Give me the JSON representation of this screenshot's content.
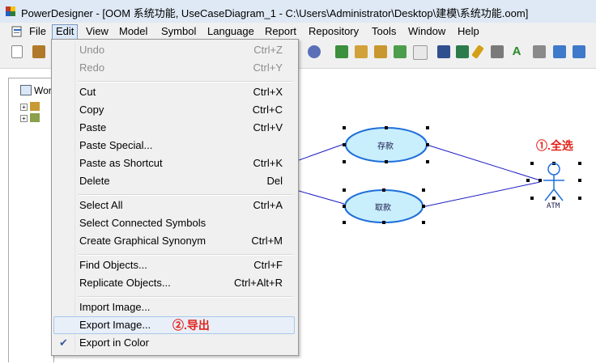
{
  "window": {
    "title": "PowerDesigner - [OOM 系统功能, UseCaseDiagram_1 - C:\\Users\\Administrator\\Desktop\\建模\\系统功能.oom]"
  },
  "menubar": {
    "items": [
      {
        "label": "File",
        "active": false
      },
      {
        "label": "Edit",
        "active": true
      },
      {
        "label": "View",
        "active": false
      },
      {
        "label": "Model",
        "active": false
      },
      {
        "label": "Symbol",
        "active": false
      },
      {
        "label": "Language",
        "active": false
      },
      {
        "label": "Report",
        "active": false
      },
      {
        "label": "Repository",
        "active": false
      },
      {
        "label": "Tools",
        "active": false
      },
      {
        "label": "Window",
        "active": false
      },
      {
        "label": "Help",
        "active": false
      }
    ]
  },
  "edit_menu": {
    "items": [
      {
        "label": "Undo",
        "shortcut": "Ctrl+Z",
        "disabled": true
      },
      {
        "label": "Redo",
        "shortcut": "Ctrl+Y",
        "disabled": true
      },
      {
        "label": "Cut",
        "shortcut": "Ctrl+X"
      },
      {
        "label": "Copy",
        "shortcut": "Ctrl+C"
      },
      {
        "label": "Paste",
        "shortcut": "Ctrl+V"
      },
      {
        "label": "Paste Special...",
        "shortcut": ""
      },
      {
        "label": "Paste as Shortcut",
        "shortcut": "Ctrl+K"
      },
      {
        "label": "Delete",
        "shortcut": "Del"
      },
      {
        "label": "Select All",
        "shortcut": "Ctrl+A"
      },
      {
        "label": "Select Connected Symbols",
        "shortcut": ""
      },
      {
        "label": "Create Graphical Synonym",
        "shortcut": "Ctrl+M"
      },
      {
        "label": "Find Objects...",
        "shortcut": "Ctrl+F"
      },
      {
        "label": "Replicate Objects...",
        "shortcut": "Ctrl+Alt+R"
      },
      {
        "label": "Import Image...",
        "shortcut": ""
      },
      {
        "label": "Export Image...",
        "shortcut": "",
        "highlighted": true
      },
      {
        "label": "Export in Color",
        "shortcut": "",
        "checked": true
      }
    ]
  },
  "browser": {
    "root_label": "Wor"
  },
  "diagram": {
    "usecase_deposit": "存款",
    "usecase_withdraw": "取款",
    "actor_label": "ATM"
  },
  "annotations": {
    "step1": "①.全选",
    "step2": "②.导出"
  },
  "colors": {
    "accent_red": "#e2231a",
    "usecase_fill": "#c9eefc",
    "usecase_stroke": "#1e6fd9",
    "menu_highlight": "#e8eff8"
  }
}
